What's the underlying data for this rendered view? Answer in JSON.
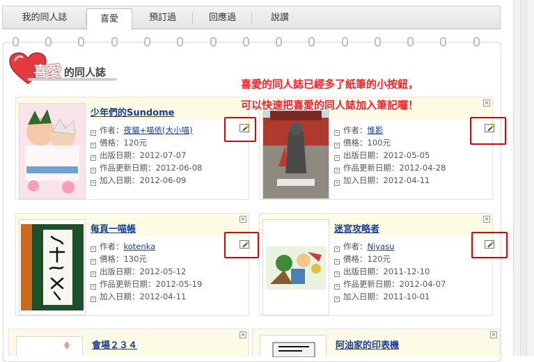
{
  "tabs": [
    {
      "label": "我的同人誌"
    },
    {
      "label": "喜愛"
    },
    {
      "label": "預訂過"
    },
    {
      "label": "回應過"
    },
    {
      "label": "說讚"
    }
  ],
  "active_tab": "喜愛",
  "panel": {
    "title_main": "喜愛",
    "title_sub": "的同人誌"
  },
  "annotation": {
    "line1": "喜愛的同人誌已經多了紙筆的小按鈕，",
    "line2": "可以快速把喜愛的同人誌加入筆記囉！"
  },
  "labels": {
    "author": "作者：",
    "price": "價格：",
    "release": "出版日期：",
    "updated": "作品更新日期：",
    "added": "加入日期："
  },
  "books": [
    {
      "title": "少年們的Sundome",
      "author": "夜貓+喵依(大小喵)",
      "price": "120元",
      "release": "2012-07-07",
      "updated": "2012-06-08",
      "added": "2012-06-09"
    },
    {
      "title": "",
      "author": "惟影",
      "price": "100元",
      "release": "2012-05-05",
      "updated": "2012-04-28",
      "added": "2012-04-11"
    },
    {
      "title": "每頁一喵帳",
      "author": "kotenka",
      "price": "130元",
      "release": "2012-05-12",
      "updated": "2012-05-19",
      "added": "2012-04-11"
    },
    {
      "title": "迷宮攻略者",
      "author": "Niyasu",
      "price": "120元",
      "release": "2011-12-10",
      "updated": "2012-04-07",
      "added": "2011-10-01"
    },
    {
      "title": "會場２３４",
      "author": "",
      "price": "",
      "release": "",
      "updated": "",
      "added": ""
    },
    {
      "title": "阿油家的印表機",
      "author": "",
      "price": "",
      "release": "",
      "updated": "",
      "added": ""
    }
  ],
  "colors": {
    "accent_red": "#e00000",
    "link_blue": "#1a3f8e",
    "title_strip": "#fdfbe6"
  },
  "icons": {
    "close": "close-icon",
    "pencil": "pencil-note-icon",
    "bullet": "list-bullet-icon",
    "heart": "heart-icon"
  }
}
